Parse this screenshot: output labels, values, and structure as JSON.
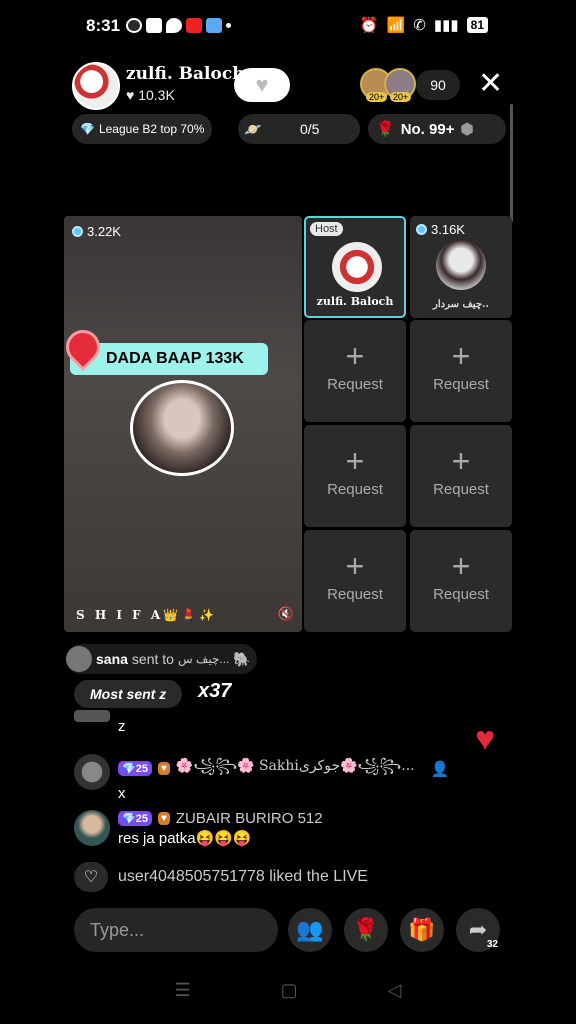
{
  "status_bar": {
    "time": "8:31",
    "battery": "81",
    "icons": [
      "whatsapp-icon",
      "youtube-icon",
      "location-icon",
      "youtube-icon",
      "app-icon",
      "dot-icon",
      "alarm-icon",
      "wifi-icon",
      "call-icon",
      "signal-icon"
    ]
  },
  "header": {
    "host_name": "zulfi. Baloch",
    "host_likes": "10.3K",
    "like_glyph": "♥",
    "follow_icon": "heart-icon",
    "viewer_badges": [
      "20+",
      "20+"
    ],
    "viewer_count": "90",
    "close_label": "✕"
  },
  "pills": {
    "league": "League B2 top 70%",
    "goal": "0/5",
    "rank": "No. 99+"
  },
  "main_guest": {
    "coins": "3.22K",
    "banner": "DADA BAAP 133K",
    "name": "S H I F A👑💄✨"
  },
  "host_cell": {
    "tag": "Host",
    "name": "zulfi. Baloch"
  },
  "guest2_cell": {
    "coins": "3.16K",
    "name": "چیف سردار.."
  },
  "request_label": "Request",
  "request_plus": "+",
  "gift": {
    "sender": "sana",
    "text": "sent to",
    "recipient": "چیف س...",
    "most_sent": "Most sent z",
    "multiplier": "x37"
  },
  "comments": [
    {
      "user": "",
      "text": "z"
    },
    {
      "user": "🌸꧁꧂🌸 Sakhiجوکری🌸꧁꧂...",
      "level": "25",
      "text": "x"
    },
    {
      "user": "ZUBAIR BURIRO 512",
      "level": "25",
      "text": "res ja patka😝😝😝"
    }
  ],
  "liked": "user4048505751778 liked the LIVE",
  "input": {
    "placeholder": "Type..."
  },
  "share_count": "32",
  "colors": {
    "accent_cyan": "#9df3ec",
    "heart_red": "#e5293a",
    "level_purple": "#7a4cf0"
  }
}
